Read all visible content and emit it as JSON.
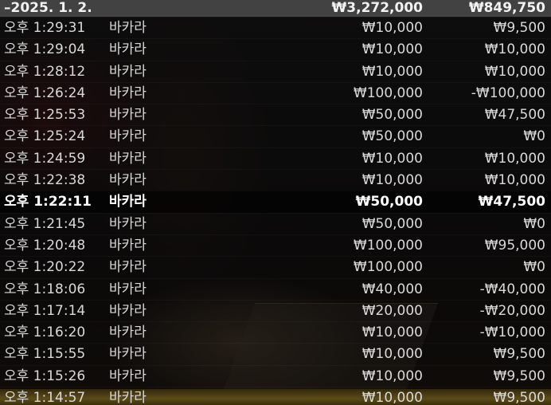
{
  "summary": {
    "date": "–2025. 1. 2.",
    "total_bet": "₩3,272,000",
    "total_win": "₩849,750"
  },
  "rows": [
    {
      "time": "오후 1:29:31",
      "game": "바카라",
      "bet": "₩10,000",
      "result": "₩9,500"
    },
    {
      "time": "오후 1:29:04",
      "game": "바카라",
      "bet": "₩10,000",
      "result": "₩10,000"
    },
    {
      "time": "오후 1:28:12",
      "game": "바카라",
      "bet": "₩10,000",
      "result": "₩10,000"
    },
    {
      "time": "오후 1:26:24",
      "game": "바카라",
      "bet": "₩100,000",
      "result": "-₩100,000"
    },
    {
      "time": "오후 1:25:53",
      "game": "바카라",
      "bet": "₩50,000",
      "result": "₩47,500"
    },
    {
      "time": "오후 1:25:24",
      "game": "바카라",
      "bet": "₩50,000",
      "result": "₩0"
    },
    {
      "time": "오후 1:24:59",
      "game": "바카라",
      "bet": "₩10,000",
      "result": "₩10,000"
    },
    {
      "time": "오후 1:22:38",
      "game": "바카라",
      "bet": "₩10,000",
      "result": "₩10,000"
    },
    {
      "time": "오후 1:22:11",
      "game": "바카라",
      "bet": "₩50,000",
      "result": "₩47,500"
    },
    {
      "time": "오후 1:21:45",
      "game": "바카라",
      "bet": "₩50,000",
      "result": "₩0"
    },
    {
      "time": "오후 1:20:48",
      "game": "바카라",
      "bet": "₩100,000",
      "result": "₩95,000"
    },
    {
      "time": "오후 1:20:22",
      "game": "바카라",
      "bet": "₩100,000",
      "result": "₩0"
    },
    {
      "time": "오후 1:18:06",
      "game": "바카라",
      "bet": "₩40,000",
      "result": "-₩40,000"
    },
    {
      "time": "오후 1:17:14",
      "game": "바카라",
      "bet": "₩20,000",
      "result": "-₩20,000"
    },
    {
      "time": "오후 1:16:20",
      "game": "바카라",
      "bet": "₩10,000",
      "result": "-₩10,000"
    },
    {
      "time": "오후 1:15:55",
      "game": "바카라",
      "bet": "₩10,000",
      "result": "₩9,500"
    },
    {
      "time": "오후 1:15:26",
      "game": "바카라",
      "bet": "₩10,000",
      "result": "₩9,500"
    },
    {
      "time": "오후 1:14:57",
      "game": "바카라",
      "bet": "₩10,000",
      "result": "₩9,500"
    }
  ],
  "highlighted_row": 8
}
